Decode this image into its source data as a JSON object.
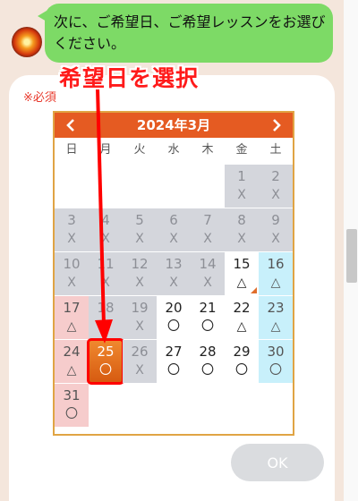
{
  "message": {
    "text": "次に、ご希望日、ご希望レッスンをお選びください。"
  },
  "form": {
    "required_label": "※必須",
    "ok_label": "OK"
  },
  "annotation": {
    "text": "希望日を選択"
  },
  "calendar": {
    "title": "2024年3月",
    "weekdays": [
      "日",
      "月",
      "火",
      "水",
      "木",
      "金",
      "土"
    ],
    "selected_day": 25,
    "days": [
      {
        "day": "1",
        "mark": "X",
        "state": "past"
      },
      {
        "day": "2",
        "mark": "X",
        "state": "past"
      },
      {
        "day": "3",
        "mark": "X",
        "state": "past"
      },
      {
        "day": "4",
        "mark": "X",
        "state": "past"
      },
      {
        "day": "5",
        "mark": "X",
        "state": "past"
      },
      {
        "day": "6",
        "mark": "X",
        "state": "past"
      },
      {
        "day": "7",
        "mark": "X",
        "state": "past"
      },
      {
        "day": "8",
        "mark": "X",
        "state": "past"
      },
      {
        "day": "9",
        "mark": "X",
        "state": "past"
      },
      {
        "day": "10",
        "mark": "X",
        "state": "past"
      },
      {
        "day": "11",
        "mark": "X",
        "state": "past"
      },
      {
        "day": "12",
        "mark": "X",
        "state": "past"
      },
      {
        "day": "13",
        "mark": "X",
        "state": "past"
      },
      {
        "day": "14",
        "mark": "X",
        "state": "past"
      },
      {
        "day": "15",
        "mark": "△",
        "state": "today"
      },
      {
        "day": "16",
        "mark": "△",
        "state": "sat"
      },
      {
        "day": "17",
        "mark": "△",
        "state": "sun"
      },
      {
        "day": "18",
        "mark": "X",
        "state": "past"
      },
      {
        "day": "19",
        "mark": "X",
        "state": "past"
      },
      {
        "day": "20",
        "mark": "〇",
        "state": "avail"
      },
      {
        "day": "21",
        "mark": "〇",
        "state": "avail"
      },
      {
        "day": "22",
        "mark": "△",
        "state": "avail"
      },
      {
        "day": "23",
        "mark": "△",
        "state": "sat"
      },
      {
        "day": "24",
        "mark": "△",
        "state": "sun"
      },
      {
        "day": "25",
        "mark": "〇",
        "state": "selected"
      },
      {
        "day": "26",
        "mark": "X",
        "state": "past"
      },
      {
        "day": "27",
        "mark": "〇",
        "state": "avail"
      },
      {
        "day": "28",
        "mark": "〇",
        "state": "avail"
      },
      {
        "day": "29",
        "mark": "〇",
        "state": "avail"
      },
      {
        "day": "30",
        "mark": "〇",
        "state": "sat"
      },
      {
        "day": "31",
        "mark": "〇",
        "state": "sun"
      }
    ]
  },
  "colors": {
    "header": "#e55b22",
    "past": "#d4d6dc",
    "sunday": "#f6cccc",
    "saturday": "#c8f0fb",
    "annotation": "#ff1a1a"
  }
}
